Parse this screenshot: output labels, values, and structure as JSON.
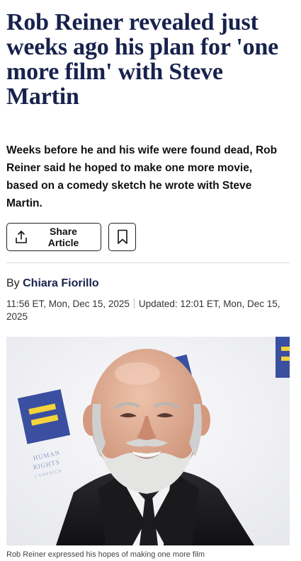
{
  "article": {
    "headline": "Rob Reiner revealed just weeks ago his plan for 'one more film' with Steve Martin",
    "dek": "Weeks before he and his wife were found dead, Rob Reiner said he hoped to make one more movie, based on a comedy sketch he wrote with Steve Martin.",
    "byline_prefix": "By",
    "author": "Chiara Fiorillo",
    "published": "11:56 ET, Mon, Dec 15, 2025",
    "updated": "Updated: 12:01 ET, Mon, Dec 15, 2025",
    "image_caption": "Rob Reiner expressed his hopes of making one more film"
  },
  "actions": {
    "share_label": "Share Article"
  },
  "icons": {
    "share": "share-icon",
    "bookmark": "bookmark-icon"
  },
  "colors": {
    "headline": "#17224d",
    "author": "#17224d",
    "backdrop_logo": "#3a4fa0",
    "backdrop_logo_accent": "#f5d33a"
  },
  "backdrop_text": "HUMAN RIGHTS CAMPAIGN"
}
